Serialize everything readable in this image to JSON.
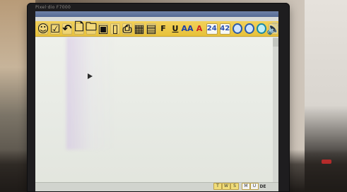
{
  "window": {
    "monitor_brand": "Pixel·dio F7000"
  },
  "toolbar": {
    "items": [
      {
        "icon": "smiley-icon",
        "label": ""
      },
      {
        "icon": "check-icon",
        "label": ""
      },
      {
        "icon": "undo-icon",
        "label": ""
      },
      {
        "icon": "new-document-icon",
        "label": ""
      },
      {
        "icon": "open-folder-icon",
        "label": ""
      },
      {
        "icon": "save-icon",
        "label": ""
      },
      {
        "icon": "print-preview-icon",
        "label": ""
      },
      {
        "icon": "print-icon",
        "label": ""
      },
      {
        "icon": "calculator-icon",
        "label": ""
      },
      {
        "icon": "grid-icon",
        "label": ""
      },
      {
        "icon": "bold-icon",
        "label": "F"
      },
      {
        "icon": "underline-icon",
        "label": "U"
      },
      {
        "icon": "uppercase-icon",
        "label": "AA"
      },
      {
        "icon": "font-color-icon",
        "label": "A"
      },
      {
        "icon": "font-size-icon",
        "label": "24"
      },
      {
        "icon": "font-size-2-icon",
        "label": "42"
      },
      {
        "icon": "circle-blue-icon",
        "label": ""
      },
      {
        "icon": "circle-blue-2-icon",
        "label": ""
      },
      {
        "icon": "circle-teal-icon",
        "label": ""
      },
      {
        "icon": "speaker-icon",
        "label": ""
      }
    ]
  },
  "statusbar": {
    "t": "T",
    "w": "W",
    "s": "S",
    "m": "M",
    "u": "U",
    "de": "DE"
  },
  "colors": {
    "toolbar_bg": "#e7c13a",
    "document_bg": "#e7eae4",
    "accent_blue": "#2b5aa8",
    "accent_red": "#cc2222"
  }
}
